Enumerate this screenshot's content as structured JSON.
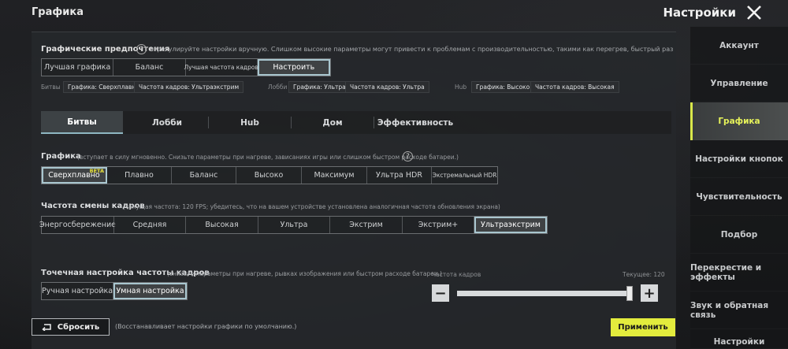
{
  "header": {
    "page_title": "Графика",
    "settings_title": "Настройки"
  },
  "sidebar": {
    "items": [
      {
        "label": "Аккаунт",
        "active": false
      },
      {
        "label": "Управление",
        "active": false
      },
      {
        "label": "Графика",
        "active": true
      },
      {
        "label": "Настройки кнопок",
        "active": false
      },
      {
        "label": "Чувствительность",
        "active": false
      },
      {
        "label": "Подбор",
        "active": false
      },
      {
        "label": "Перекрестие и эффекты",
        "active": false
      },
      {
        "label": "Звук и обратная связь",
        "active": false
      },
      {
        "label": "Настройки",
        "active": false
      }
    ]
  },
  "preferences": {
    "title": "Графические предпочтения",
    "help": "?",
    "description": "отрегулируйте настройки вручную. Слишком высокие параметры могут привести к проблемам с производительностью, такими как перегрев, быстрый разряд батареи или подв",
    "options": [
      "Лучшая графика",
      "Баланс",
      "Лучшая частота кадров",
      "Настроить"
    ],
    "selected": "Настроить"
  },
  "mode_summary": {
    "battle": {
      "label": "Битвы",
      "graphics": "Графика: Сверхплавно",
      "fps": "Частота кадров: Ультраэкстрим"
    },
    "lobby": {
      "label": "Лобби",
      "graphics": "Графика: Ультра",
      "fps": "Частота кадров: Ультра"
    },
    "hub": {
      "label": "Hub",
      "graphics": "Графика: Высоко",
      "fps": "Частота кадров: Высокая"
    }
  },
  "tabs": {
    "items": [
      "Битвы",
      "Лобби",
      "Hub",
      "Дом",
      "Эффективность"
    ],
    "active": "Битвы"
  },
  "graphics": {
    "title": "Графика",
    "note": "(вступает в силу мгновенно. Снизьте параметры при нагреве, зависаниях игры или слишком быстром расходе батареи.)",
    "help": "?",
    "options": [
      "Сверхплавно",
      "Плавно",
      "Баланс",
      "Высоко",
      "Максимум",
      "Ультра HDR",
      "Экстремальный HDR"
    ],
    "selected": "Сверхплавно",
    "beta_label": "BETA"
  },
  "frame_rate": {
    "title": "Частота смены кадров",
    "note": "(текущая частота: 120 FPS; убедитесь, что на вашем устройстве установлена аналогичная частота обновления экрана)",
    "options": [
      "Энергосбережение",
      "Средняя",
      "Высокая",
      "Ультра",
      "Экстрим",
      "Экстрим+",
      "Ультраэкстрим"
    ],
    "selected": "Ультраэкстрим"
  },
  "fine_tune": {
    "title": "Точечная настройка частоты кадров",
    "note": "(снизьте параметры при нагреве, рывках изображения или быстром расходе батареи.)",
    "options": [
      "Ручная настройка",
      "Умная настройка"
    ],
    "selected": "Умная настройка",
    "slider_label": "Частота кадров",
    "current_label": "Текущее: 120",
    "minus": "−",
    "plus": "+",
    "slider_fraction": 1.0
  },
  "footer": {
    "reset_label": "Сбросить",
    "reset_desc": "(Восстанавливает настройки графики по умолчанию.)",
    "apply_label": "Применить"
  },
  "colors": {
    "accent_yellow": "#e3ec3d",
    "selection_outline": "#a9c6cf",
    "background": "#1c1d1f"
  }
}
